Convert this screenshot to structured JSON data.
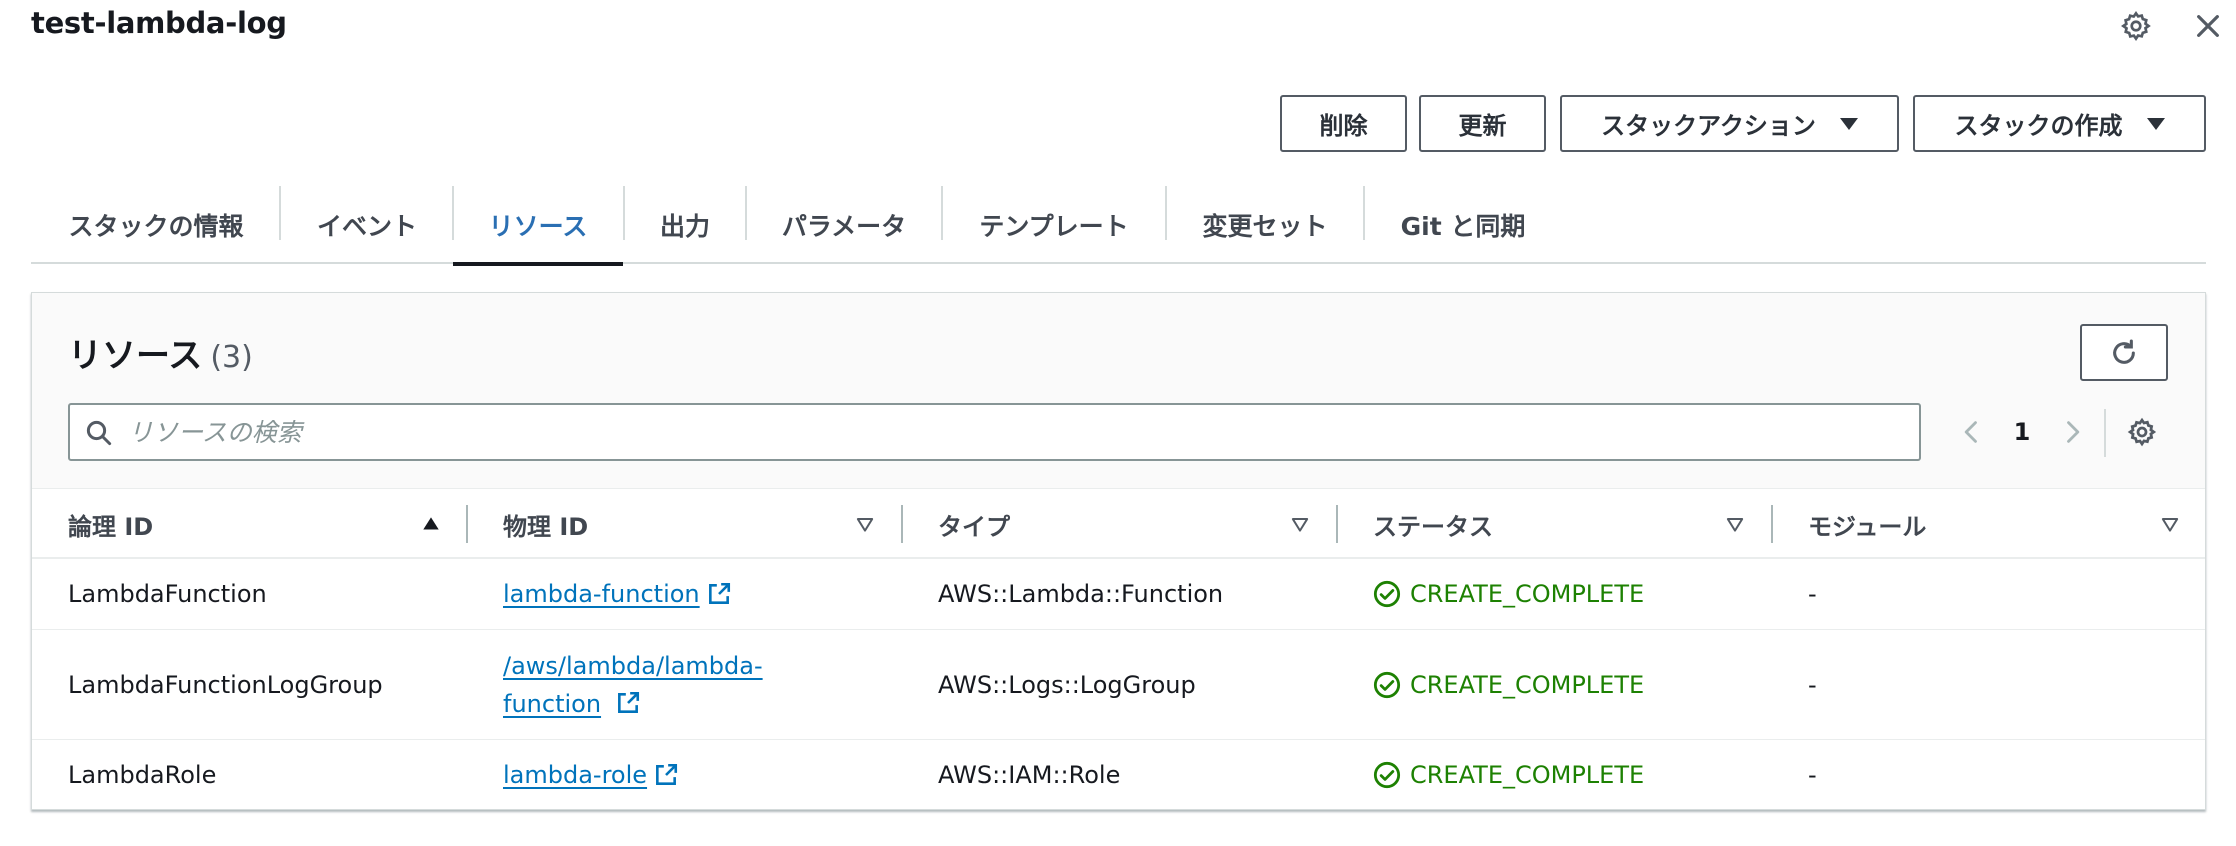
{
  "header": {
    "title": "test-lambda-log",
    "settings_icon": "gear-icon",
    "close_icon": "close-icon"
  },
  "actions": {
    "delete": "削除",
    "update": "更新",
    "stack_actions": "スタックアクション",
    "create_stack": "スタックの作成"
  },
  "tabs": [
    {
      "label": "スタックの情報",
      "active": false
    },
    {
      "label": "イベント",
      "active": false
    },
    {
      "label": "リソース",
      "active": true
    },
    {
      "label": "出力",
      "active": false
    },
    {
      "label": "パラメータ",
      "active": false
    },
    {
      "label": "テンプレート",
      "active": false
    },
    {
      "label": "変更セット",
      "active": false
    },
    {
      "label": "Git と同期",
      "active": false
    }
  ],
  "resources": {
    "title": "リソース",
    "count": "(3)",
    "search_placeholder": "リソースの検索",
    "page": "1",
    "columns": [
      "論理 ID",
      "物理 ID",
      "タイプ",
      "ステータス",
      "モジュール"
    ],
    "rows": [
      {
        "logical_id": "LambdaFunction",
        "physical_id": "lambda-function",
        "type": "AWS::Lambda::Function",
        "status": "CREATE_COMPLETE",
        "module": "-"
      },
      {
        "logical_id": "LambdaFunctionLogGroup",
        "physical_id_line1": "/aws/lambda/lambda-",
        "physical_id_line2": "function",
        "type": "AWS::Logs::LogGroup",
        "status": "CREATE_COMPLETE",
        "module": "-"
      },
      {
        "logical_id": "LambdaRole",
        "physical_id": "lambda-role",
        "type": "AWS::IAM::Role",
        "status": "CREATE_COMPLETE",
        "module": "-"
      }
    ]
  },
  "colors": {
    "link": "#0073bb",
    "success": "#1d8102",
    "active_tab": "#2a6fb3"
  }
}
